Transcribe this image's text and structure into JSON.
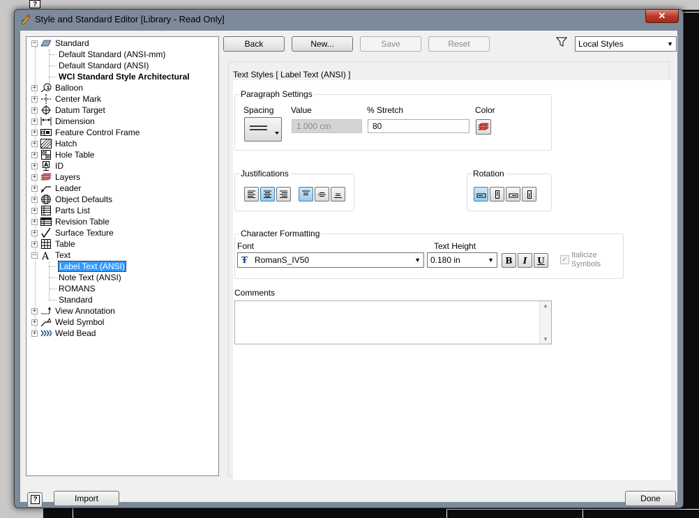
{
  "window": {
    "title": "Style and Standard Editor [Library - Read Only]",
    "close_label": "✕"
  },
  "tree": {
    "items": [
      {
        "label": "Standard",
        "icon": "standard-icon",
        "level": 0,
        "expander": "−",
        "bold": false,
        "selected": false
      },
      {
        "label": "Default Standard (ANSI-mm)",
        "level": 1,
        "bold": false,
        "selected": false
      },
      {
        "label": "Default Standard (ANSI)",
        "level": 1,
        "bold": false,
        "selected": false
      },
      {
        "label": "WCI Standard Style Architectural",
        "level": 1,
        "bold": true,
        "selected": false
      },
      {
        "label": "Balloon",
        "icon": "balloon-icon",
        "level": 0,
        "expander": "+"
      },
      {
        "label": "Center Mark",
        "icon": "center-mark-icon",
        "level": 0,
        "expander": "+"
      },
      {
        "label": "Datum Target",
        "icon": "datum-target-icon",
        "level": 0,
        "expander": "+"
      },
      {
        "label": "Dimension",
        "icon": "dimension-icon",
        "level": 0,
        "expander": "+"
      },
      {
        "label": "Feature Control Frame",
        "icon": "feature-control-frame-icon",
        "level": 0,
        "expander": "+"
      },
      {
        "label": "Hatch",
        "icon": "hatch-icon",
        "level": 0,
        "expander": "+"
      },
      {
        "label": "Hole Table",
        "icon": "hole-table-icon",
        "level": 0,
        "expander": "+"
      },
      {
        "label": "ID",
        "icon": "id-icon",
        "level": 0,
        "expander": "+"
      },
      {
        "label": "Layers",
        "icon": "layers-icon",
        "level": 0,
        "expander": "+"
      },
      {
        "label": "Leader",
        "icon": "leader-icon",
        "level": 0,
        "expander": "+"
      },
      {
        "label": "Object Defaults",
        "icon": "globe-icon",
        "level": 0,
        "expander": "+"
      },
      {
        "label": "Parts List",
        "icon": "parts-list-icon",
        "level": 0,
        "expander": "+"
      },
      {
        "label": "Revision Table",
        "icon": "revision-table-icon",
        "level": 0,
        "expander": "+"
      },
      {
        "label": "Surface Texture",
        "icon": "surface-texture-icon",
        "level": 0,
        "expander": "+"
      },
      {
        "label": "Table",
        "icon": "table-icon",
        "level": 0,
        "expander": "+"
      },
      {
        "label": "Text",
        "icon": "text-icon",
        "level": 0,
        "expander": "−"
      },
      {
        "label": "Label Text (ANSI)",
        "level": 1,
        "selected": true
      },
      {
        "label": "Note Text (ANSI)",
        "level": 1
      },
      {
        "label": "ROMANS",
        "level": 1
      },
      {
        "label": "Standard",
        "level": 1
      },
      {
        "label": "View Annotation",
        "icon": "view-annotation-icon",
        "level": 0,
        "expander": "+"
      },
      {
        "label": "Weld Symbol",
        "icon": "weld-symbol-icon",
        "level": 0,
        "expander": "+"
      },
      {
        "label": "Weld Bead",
        "icon": "weld-bead-icon",
        "level": 0,
        "expander": "+"
      }
    ]
  },
  "toolbar": {
    "back_label": "Back",
    "new_label": "New...",
    "save_label": "Save",
    "reset_label": "Reset",
    "filter_value": "Local Styles"
  },
  "pane": {
    "title": "Text Styles [ Label Text (ANSI) ]",
    "paragraph": {
      "group_title": "Paragraph Settings",
      "spacing_label": "Spacing",
      "value_label": "Value",
      "value": "1.000 cm",
      "stretch_label": "% Stretch",
      "stretch_value": "80",
      "color_label": "Color"
    },
    "justifications": {
      "group_title": "Justifications"
    },
    "rotation": {
      "group_title": "Rotation"
    },
    "character": {
      "group_title": "Character Formatting",
      "font_label": "Font",
      "font_value": "RomanS_IV50",
      "height_label": "Text Height",
      "height_value": "0.180 in",
      "bold_label": "B",
      "italic_label": "I",
      "underline_label": "U",
      "italicize_label_1": "Italicize",
      "italicize_label_2": "Symbols"
    },
    "comments": {
      "label": "Comments",
      "value": ""
    }
  },
  "footer": {
    "import_label": "Import",
    "done_label": "Done"
  }
}
